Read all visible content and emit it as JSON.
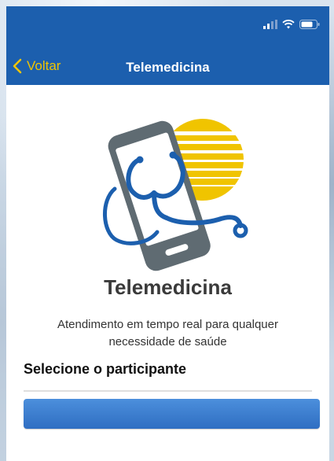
{
  "nav": {
    "back_label": "Voltar",
    "title": "Telemedicina"
  },
  "status_bar": {
    "icons": [
      "cellular-signal-icon",
      "wifi-icon",
      "battery-icon"
    ]
  },
  "hero": {
    "icon": "telemedicine-phone-stethoscope-illustration",
    "colors": {
      "primary": "#1c5fae",
      "accent": "#f0c400",
      "device": "#5f6b72"
    }
  },
  "content": {
    "service_title": "Telemedicina",
    "service_description": "Atendimento em tempo real para qualquer necessidade de saúde",
    "section_label": "Selecione o participante",
    "participant_selected": ""
  },
  "theme": {
    "header_blue": "#1c5fae",
    "back_yellow": "#f0c400",
    "button_blue": "#2f6ec2"
  }
}
